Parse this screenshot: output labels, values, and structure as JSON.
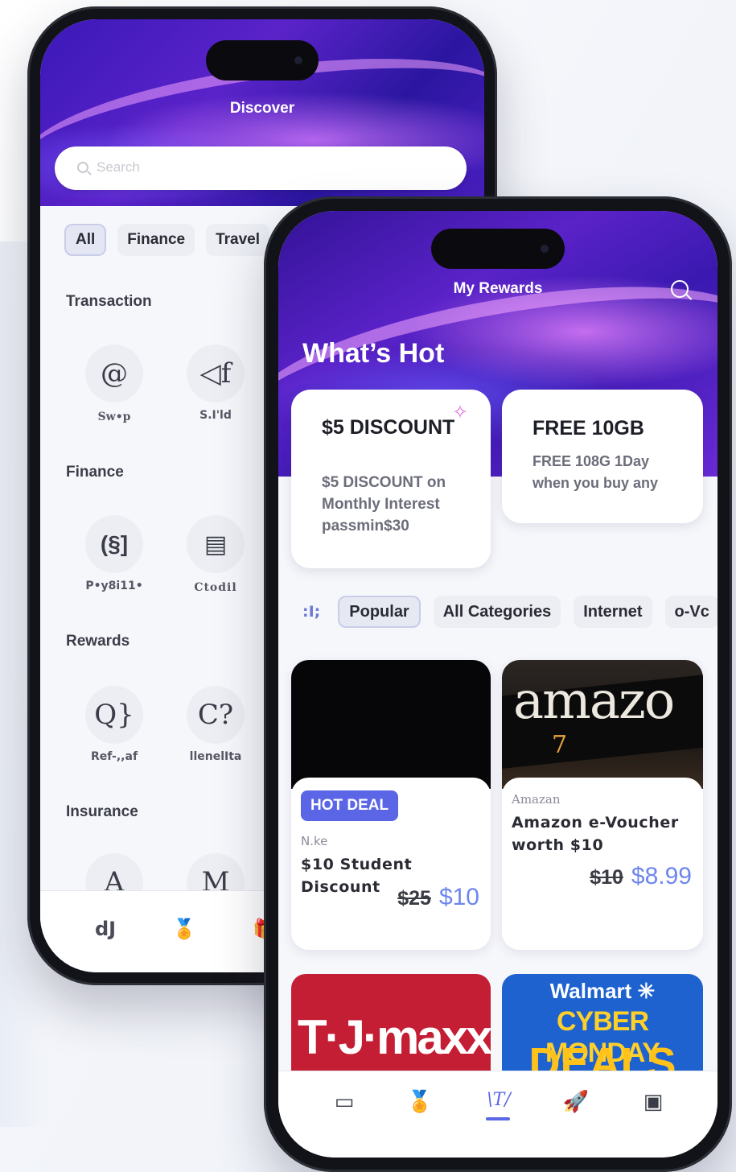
{
  "back_phone": {
    "title": "Discover",
    "search_placeholder": "Search",
    "chips": [
      "All",
      "Finance",
      "Travel"
    ],
    "sections": {
      "transaction": "Transaction",
      "finance": "Finance",
      "rewards": "Rewards",
      "insurance": "Insurance"
    },
    "icons": {
      "swap_glyph": "@",
      "swap_label": "Sw•p",
      "send_glyph": "◁f",
      "send_label": "S.I'ld",
      "pay_glyph": "(§]",
      "pay_label": "P•y8i11•",
      "credit_glyph": "▤",
      "credit_label": "Ctodil",
      "referral_glyph": "Q}",
      "referral_label": "Ref-,,af",
      "benefits_glyph": "C?",
      "benefits_label": "llenelIta",
      "ins1_glyph": "A",
      "ins2_glyph": "M"
    },
    "nav": {
      "item1": "dJ",
      "item2": "🏅",
      "item3": "🎁"
    }
  },
  "front_phone": {
    "title": "My Rewards",
    "headline": "What’s Hot",
    "promo1": {
      "title": "$5 DISCOUNT",
      "desc": "$5 DISCOUNT on Monthly Interest passmin$30",
      "icon": "sparkle-icon"
    },
    "promo2": {
      "title": "FREE 10GB",
      "desc": "FREE 108G 1Day when you buy any"
    },
    "chips_prefix": ":I;",
    "chips": [
      "Popular",
      "All Categories",
      "Internet",
      "o-Vc"
    ],
    "products": [
      {
        "badge": "HOT DEAL",
        "brand": "N.ke",
        "name": "$10 Student Discount",
        "old_price": "$25",
        "new_price": "$10"
      },
      {
        "image_text": "amazo",
        "image_mark": "7",
        "brand": "Amazan",
        "name": "Amazon e-Voucher worth $10",
        "old_price": "$10",
        "new_price": "$8.99"
      }
    ],
    "tiles": {
      "tj": "T·J·maxx",
      "walmart1": "Walmart ✳",
      "walmart2": "CYBER MONDAY",
      "walmart3": "DEALS"
    },
    "nav": {
      "wallet": "▭",
      "rewards": "🏅",
      "active": "\\T/",
      "rocket": "🚀",
      "store": "▣"
    }
  },
  "colors": {
    "accent": "#5b66e6",
    "price_new": "#6d86ee",
    "hero_purple": "#4a1fc0",
    "tj_red": "#c41e34",
    "walmart_blue": "#1e62d0"
  }
}
